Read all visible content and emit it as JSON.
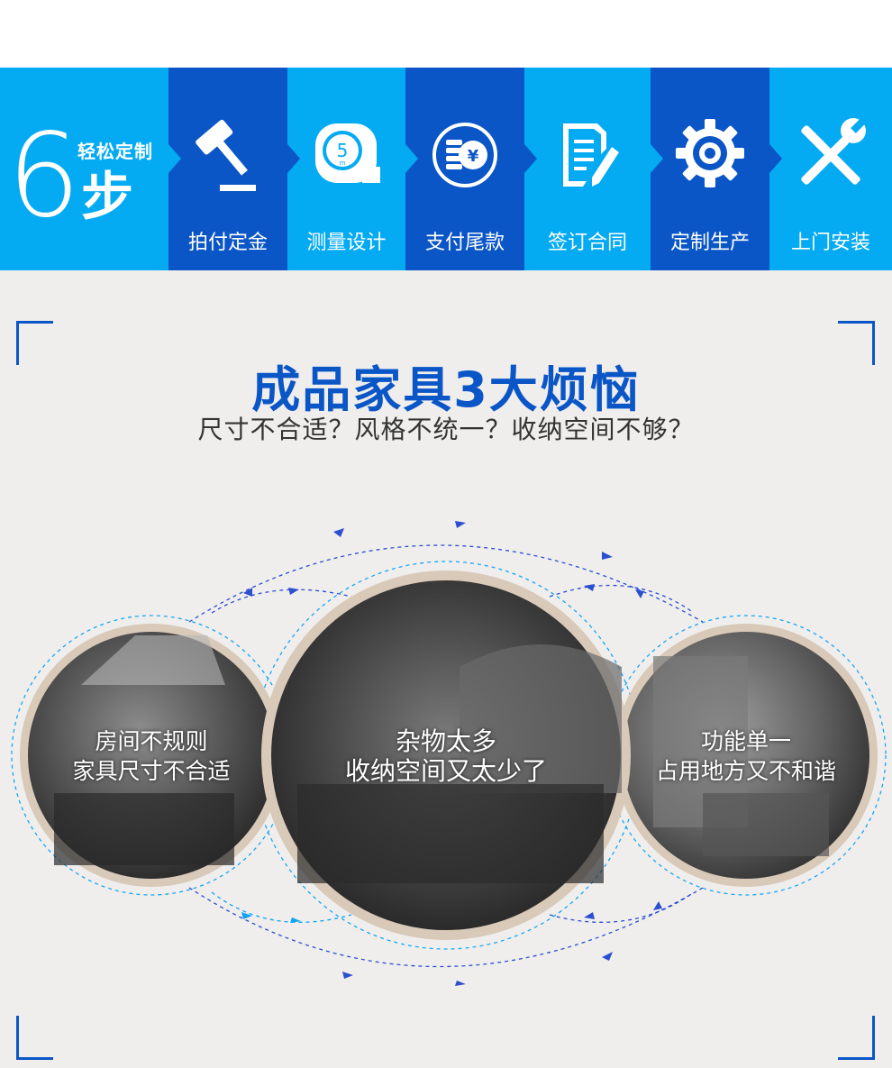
{
  "banner": {
    "number": "6",
    "tagline": "轻松定制",
    "step_word": "步",
    "steps": [
      {
        "label": "拍付定金",
        "icon": "gavel-icon"
      },
      {
        "label": "测量设计",
        "icon": "tape-measure-icon"
      },
      {
        "label": "支付尾款",
        "icon": "yen-coin-icon"
      },
      {
        "label": "签订合同",
        "icon": "contract-pen-icon"
      },
      {
        "label": "定制生产",
        "icon": "gear-icon"
      },
      {
        "label": "上门安装",
        "icon": "tools-icon"
      }
    ],
    "tape_number": "5",
    "tape_unit": "m",
    "coin_symbol": "¥"
  },
  "main": {
    "title": "成品家具3大烦恼",
    "subtitle": "尺寸不合适？风格不统一？收纳空间不够？"
  },
  "circles": [
    {
      "line1": "房间不规则",
      "line2": "家具尺寸不合适"
    },
    {
      "line1": "杂物太多",
      "line2": "收纳空间又太少了"
    },
    {
      "line1": "功能单一",
      "line2": "占用地方又不和谐"
    }
  ],
  "colors": {
    "light_blue": "#04aaf2",
    "dark_blue": "#0b56c7",
    "background": "#efeeed",
    "title_blue": "#0b56c7"
  }
}
